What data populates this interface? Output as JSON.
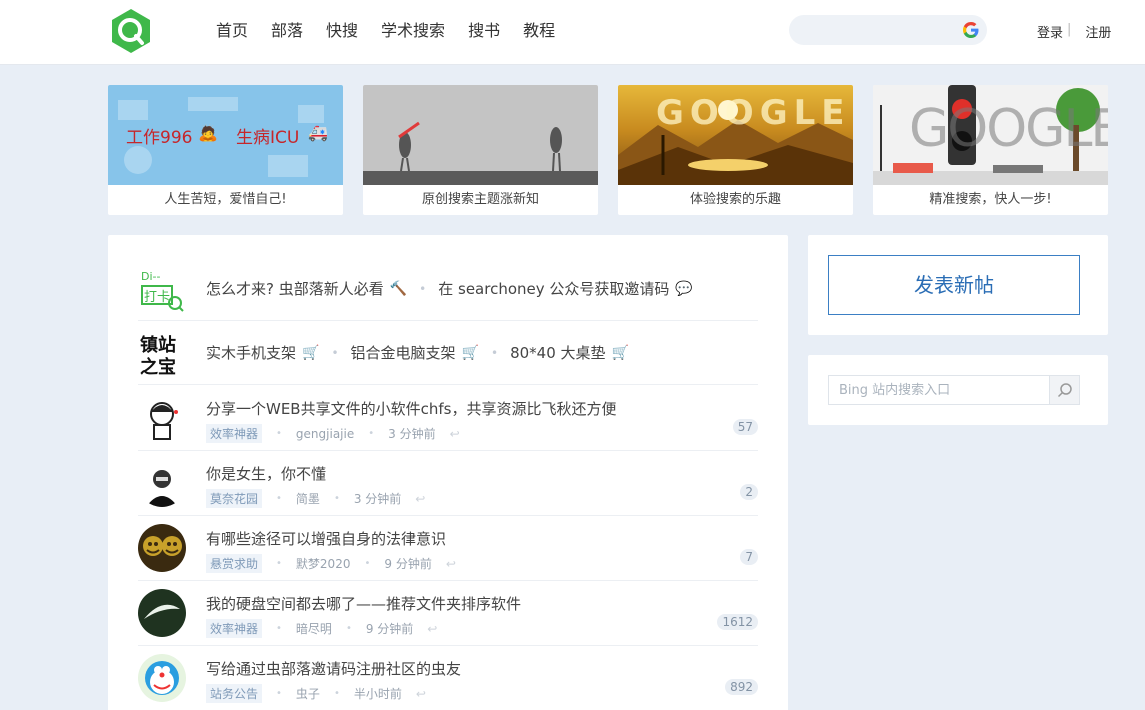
{
  "header": {
    "nav": [
      "首页",
      "部落",
      "快搜",
      "学术搜索",
      "搜书",
      "教程"
    ],
    "search_placeholder": "",
    "login": "登录",
    "separator": "|",
    "register": "注册"
  },
  "banners": [
    {
      "caption": "人生苦短，爱惜自己!",
      "text_left": "工作996",
      "text_right": "生病ICU"
    },
    {
      "caption": "原创搜索主题涨新知"
    },
    {
      "caption": "体验搜索的乐趣",
      "logo_text": "GOOGLE"
    },
    {
      "caption": "精准搜索，快人一步!",
      "logo_text": "GOOGLE"
    }
  ],
  "pinned": [
    {
      "icon_text": [
        "Di--",
        "打卡"
      ],
      "links": [
        "怎么才来? 虫部落新人必看",
        "在 searchoney 公众号获取邀请码"
      ]
    },
    {
      "icon_text": [
        "镇站",
        "之宝"
      ],
      "links": [
        "实木手机支架",
        "铝合金电脑支架",
        "80*40 大桌垫"
      ]
    }
  ],
  "topics": [
    {
      "title": "分享一个WEB共享文件的小软件chfs，共享资源比飞秋还方便",
      "tag": "效率神器",
      "author": "gengjiajie",
      "time": "3 分钟前",
      "count": "57"
    },
    {
      "title": "你是女生，你不懂",
      "tag": "莫奈花园",
      "author": "简墨",
      "time": "3 分钟前",
      "count": "2"
    },
    {
      "title": "有哪些途径可以增强自身的法律意识",
      "tag": "悬赏求助",
      "author": "默梦2020",
      "time": "9 分钟前",
      "count": "7"
    },
    {
      "title": "我的硬盘空间都去哪了——推荐文件夹排序软件",
      "tag": "效率神器",
      "author": "暗尽明",
      "time": "9 分钟前",
      "count": "1612"
    },
    {
      "title": "写给通过虫部落邀请码注册社区的虫友",
      "tag": "站务公告",
      "author": "虫子",
      "time": "半小时前",
      "count": "892"
    }
  ],
  "sidebar": {
    "post_button": "发表新帖",
    "bing_placeholder": "Bing 站内搜索入口"
  },
  "colors": {
    "brand_green": "#3fb84a",
    "link_blue": "#2a6db5"
  }
}
